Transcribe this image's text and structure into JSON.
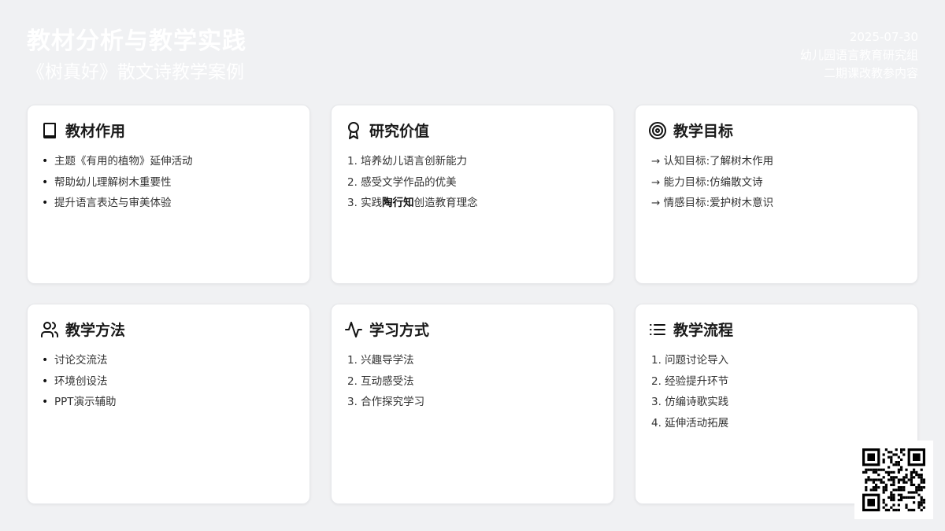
{
  "header": {
    "title": "教材分析与教学实践",
    "subtitle": "《树真好》散文诗教学案例"
  },
  "meta": {
    "date": "2025-07-30",
    "group": "幼儿园语言教育研究组",
    "source": "二期课改教参内容"
  },
  "cards": [
    {
      "title": "教材作用",
      "icon": "book-icon",
      "items": [
        "主题《有用的植物》延伸活动",
        "帮助幼儿理解树木重要性",
        "提升语言表达与审美体验"
      ]
    },
    {
      "title": "研究价值",
      "icon": "award-icon",
      "items": [
        "1. 培养幼儿语言创新能力",
        "2. 感受文学作品的优美"
      ],
      "item3": {
        "prefix": "3. 实践",
        "emphasis": "陶行知",
        "suffix": "创造教育理念"
      }
    },
    {
      "title": "教学目标",
      "icon": "target-icon",
      "items": [
        "→ 认知目标:了解树木作用",
        "→ 能力目标:仿编散文诗",
        "→ 情感目标:爱护树木意识"
      ]
    },
    {
      "title": "教学方法",
      "icon": "users-icon",
      "items": [
        "讨论交流法",
        "环境创设法",
        "PPT演示辅助"
      ]
    },
    {
      "title": "学习方式",
      "icon": "activity-icon",
      "items": [
        "1. 兴趣导学法",
        "2. 互动感受法",
        "3. 合作探究学习"
      ]
    },
    {
      "title": "教学流程",
      "icon": "list-icon",
      "items": [
        "1. 问题讨论导入",
        "2. 经验提升环节",
        "3. 仿编诗歌实践",
        "4. 延伸活动拓展"
      ]
    }
  ],
  "qr": {
    "icon": "qr-code-icon"
  }
}
